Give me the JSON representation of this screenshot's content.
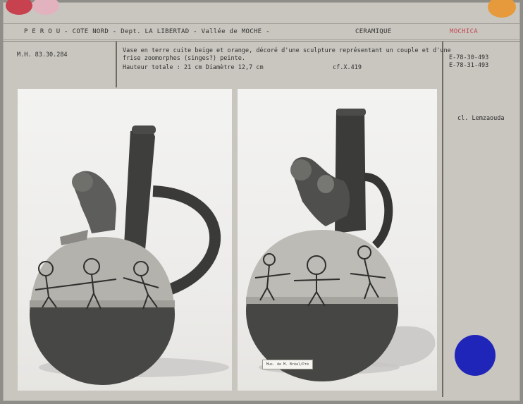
{
  "header": {
    "location": "P E R O U   -   COTE NORD   -   Dept. LA LIBERTAD   -   Vallée de MOCHE  -",
    "category": "CERAMIQUE",
    "culture": "MOCHICA"
  },
  "record": {
    "inventory_number": "M.H. 83.30.284",
    "description_line1": "Vase en terre cuite beige et orange, décoré d'une sculpture représentant un couple et d'une",
    "description_line2": "frise zoomorphes (singes?) peinte.",
    "dimensions": "Hauteur totale : 21 cm  Diamètre 12,7 cm",
    "cross_reference": "cf.X.419",
    "negative_numbers": [
      "E-78-30-493",
      "E-78-31-493"
    ],
    "photo_credit": "cl. Lemzaouda"
  },
  "photos": [
    {
      "name": "vessel-front-view"
    },
    {
      "name": "vessel-angled-view",
      "label_tag": "Mus. de M. Bréal/Prè"
    }
  ],
  "colors": {
    "card": "#c9c6bf",
    "accent_red": "#c8414e",
    "accent_pink": "#e3b2bf",
    "accent_orange": "#e69a3c",
    "accent_blue": "#1f25b8"
  }
}
